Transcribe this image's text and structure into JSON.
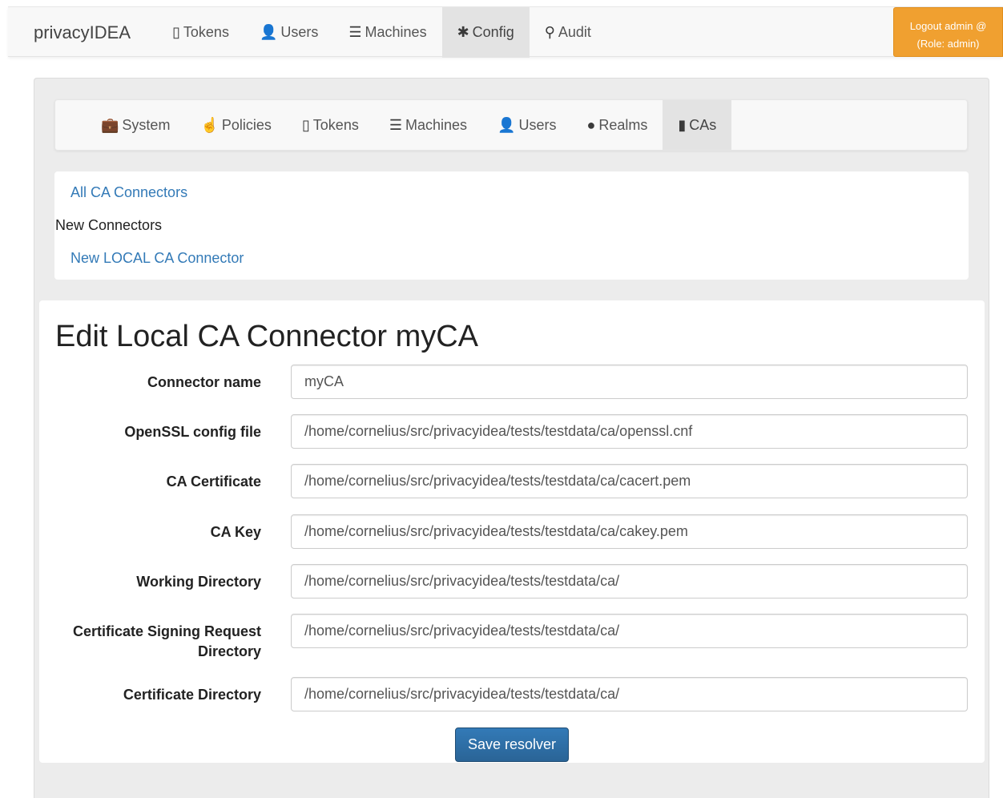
{
  "app": {
    "brand": "privacyIDEA"
  },
  "topnav": {
    "items": [
      {
        "icon": "▯",
        "label": "Tokens"
      },
      {
        "icon": "👤",
        "label": "Users"
      },
      {
        "icon": "☰",
        "label": "Machines"
      },
      {
        "icon": "✱",
        "label": "Config"
      },
      {
        "icon": "⚲",
        "label": "Audit"
      }
    ],
    "logout_line1": "Logout admin @",
    "logout_line2": "(Role: admin)"
  },
  "subnav": {
    "items": [
      {
        "icon": "💼",
        "label": "System"
      },
      {
        "icon": "☝",
        "label": "Policies"
      },
      {
        "icon": "▯",
        "label": "Tokens"
      },
      {
        "icon": "☰",
        "label": "Machines"
      },
      {
        "icon": "👤",
        "label": "Users"
      },
      {
        "icon": "●",
        "label": "Realms"
      },
      {
        "icon": "▮",
        "label": "CAs"
      }
    ]
  },
  "links": {
    "all": "All CA Connectors",
    "new_header": "New Connectors",
    "new_local": "New LOCAL CA Connector"
  },
  "form": {
    "title": "Edit Local CA Connector myCA",
    "fields": [
      {
        "label": "Connector name",
        "value": "myCA"
      },
      {
        "label": "OpenSSL config file",
        "value": "/home/cornelius/src/privacyidea/tests/testdata/ca/openssl.cnf"
      },
      {
        "label": "CA Certificate",
        "value": "/home/cornelius/src/privacyidea/tests/testdata/ca/cacert.pem"
      },
      {
        "label": "CA Key",
        "value": "/home/cornelius/src/privacyidea/tests/testdata/ca/cakey.pem"
      },
      {
        "label": "Working Directory",
        "value": "/home/cornelius/src/privacyidea/tests/testdata/ca/"
      },
      {
        "label": "Certificate Signing Request Directory",
        "value": "/home/cornelius/src/privacyidea/tests/testdata/ca/"
      },
      {
        "label": "Certificate Directory",
        "value": "/home/cornelius/src/privacyidea/tests/testdata/ca/"
      }
    ],
    "save_label": "Save resolver"
  }
}
